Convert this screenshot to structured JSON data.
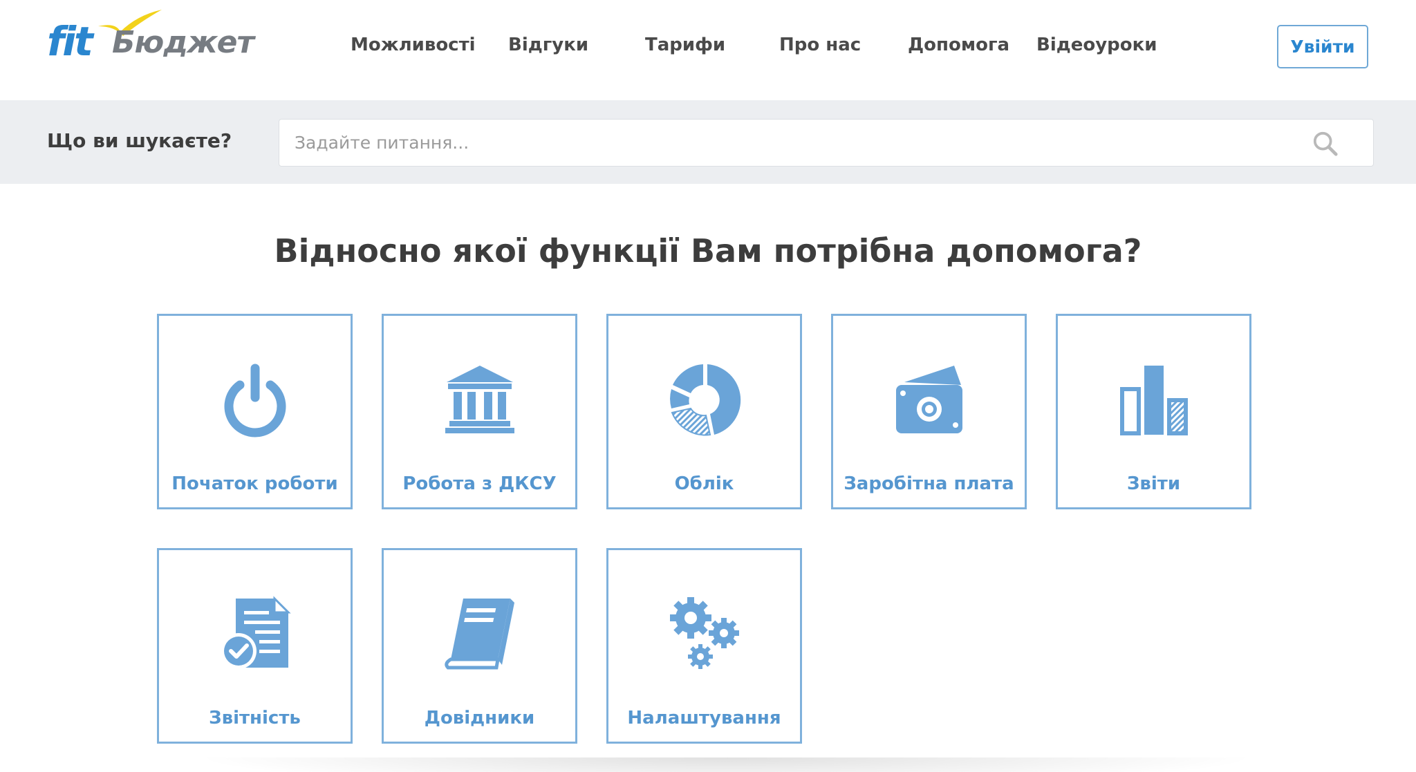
{
  "logo": {
    "brand": "fit",
    "name": "Бюджет"
  },
  "nav": [
    {
      "label": "Можливості"
    },
    {
      "label": "Відгуки"
    },
    {
      "label": "Тарифи"
    },
    {
      "label": "Про нас"
    },
    {
      "label": "Допомога"
    },
    {
      "label": "Відеоуроки"
    }
  ],
  "login": {
    "label": "Увійти"
  },
  "search": {
    "label": "Що ви шукаєте?",
    "placeholder": "Задайте питання..."
  },
  "main": {
    "heading": "Відносно якої функції Вам потрібна допомога?"
  },
  "tiles": [
    {
      "label": "Початок роботи",
      "icon": "power-icon"
    },
    {
      "label": "Робота з ДКСУ",
      "icon": "bank-icon"
    },
    {
      "label": "Облік",
      "icon": "pie-chart-icon"
    },
    {
      "label": "Заробітна плата",
      "icon": "money-icon"
    },
    {
      "label": "Звіти",
      "icon": "bar-chart-icon"
    },
    {
      "label": "Звітність",
      "icon": "document-check-icon"
    },
    {
      "label": "Довідники",
      "icon": "book-icon"
    },
    {
      "label": "Налаштування",
      "icon": "gears-icon"
    }
  ],
  "colors": {
    "accent": "#2a86cf",
    "tile_border": "#7fb1dc",
    "icon": "#6aa4d8",
    "band": "#eceef1"
  }
}
